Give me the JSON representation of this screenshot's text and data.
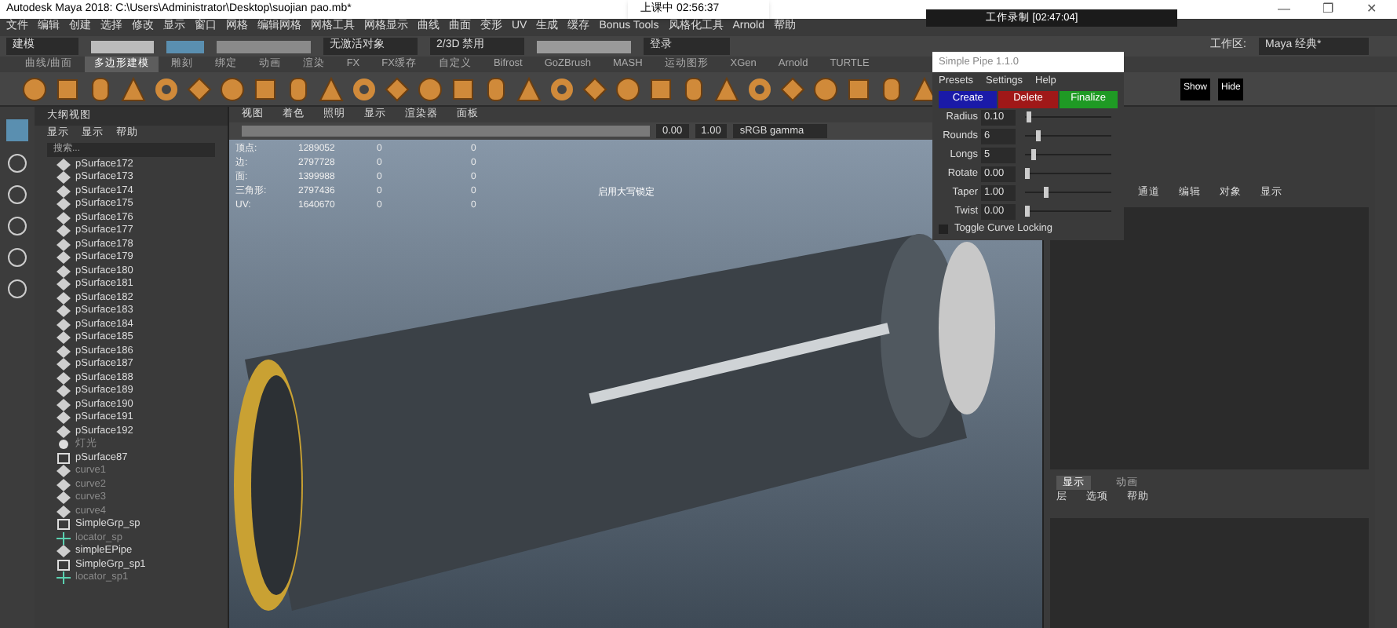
{
  "window": {
    "title": "Autodesk Maya 2018: C:\\Users\\Administrator\\Desktop\\suojian pao.mb*",
    "controls": [
      "—",
      "❐",
      "✕"
    ]
  },
  "recording_badge": {
    "text": "上课中 02:56:37"
  },
  "recorder_bar": {
    "text": "工作录制 [02:47:04]"
  },
  "menu_bar": [
    "文件",
    "编辑",
    "创建",
    "选择",
    "修改",
    "显示",
    "窗口",
    "网格",
    "编辑网格",
    "网格工具",
    "网格显示",
    "曲线",
    "曲面",
    "变形",
    "UV",
    "生成",
    "缓存",
    "Bonus Tools",
    "风格化工具",
    "Arnold",
    "帮助"
  ],
  "status_line": {
    "mode": "建模",
    "field_1": "无激活对象",
    "field_2": "2/3D 禁用",
    "login": "登录",
    "workspace_label": "工作区:",
    "workspace": "Maya 经典*"
  },
  "shelf_tabs": [
    {
      "label": "曲线/曲面",
      "selected": false
    },
    {
      "label": "多边形建模",
      "selected": true
    },
    {
      "label": "雕刻",
      "selected": false
    },
    {
      "label": "绑定",
      "selected": false
    },
    {
      "label": "动画",
      "selected": false
    },
    {
      "label": "渲染",
      "selected": false
    },
    {
      "label": "FX",
      "selected": false
    },
    {
      "label": "FX缓存",
      "selected": false
    },
    {
      "label": "自定义",
      "selected": false
    },
    {
      "label": "Bifrost",
      "selected": false
    },
    {
      "label": "GoZBrush",
      "selected": false
    },
    {
      "label": "MASH",
      "selected": false
    },
    {
      "label": "运动图形",
      "selected": false
    },
    {
      "label": "XGen",
      "selected": false
    },
    {
      "label": "Arnold",
      "selected": false
    },
    {
      "label": "TURTLE",
      "selected": false
    }
  ],
  "outliner": {
    "title": "大纲视图",
    "menu": [
      "显示",
      "显示",
      "帮助"
    ],
    "search": {
      "placeholder": "搜索..."
    },
    "items": [
      {
        "name": "pSurface172",
        "kind": "mesh",
        "hidden": false
      },
      {
        "name": "pSurface173",
        "kind": "mesh",
        "hidden": false
      },
      {
        "name": "pSurface174",
        "kind": "mesh",
        "hidden": false
      },
      {
        "name": "pSurface175",
        "kind": "mesh",
        "hidden": false
      },
      {
        "name": "pSurface176",
        "kind": "mesh",
        "hidden": false
      },
      {
        "name": "pSurface177",
        "kind": "mesh",
        "hidden": false
      },
      {
        "name": "pSurface178",
        "kind": "mesh",
        "hidden": false
      },
      {
        "name": "pSurface179",
        "kind": "mesh",
        "hidden": false
      },
      {
        "name": "pSurface180",
        "kind": "mesh",
        "hidden": false
      },
      {
        "name": "pSurface181",
        "kind": "mesh",
        "hidden": false
      },
      {
        "name": "pSurface182",
        "kind": "mesh",
        "hidden": false
      },
      {
        "name": "pSurface183",
        "kind": "mesh",
        "hidden": false
      },
      {
        "name": "pSurface184",
        "kind": "mesh",
        "hidden": false
      },
      {
        "name": "pSurface185",
        "kind": "mesh",
        "hidden": false
      },
      {
        "name": "pSurface186",
        "kind": "mesh",
        "hidden": false
      },
      {
        "name": "pSurface187",
        "kind": "mesh",
        "hidden": false
      },
      {
        "name": "pSurface188",
        "kind": "mesh",
        "hidden": false
      },
      {
        "name": "pSurface189",
        "kind": "mesh",
        "hidden": false
      },
      {
        "name": "pSurface190",
        "kind": "mesh",
        "hidden": false
      },
      {
        "name": "pSurface191",
        "kind": "mesh",
        "hidden": false
      },
      {
        "name": "pSurface192",
        "kind": "mesh",
        "hidden": false
      },
      {
        "name": "灯光",
        "kind": "light",
        "hidden": true
      },
      {
        "name": "pSurface87",
        "kind": "group",
        "hidden": false
      },
      {
        "name": "curve1",
        "kind": "mesh",
        "hidden": true
      },
      {
        "name": "curve2",
        "kind": "mesh",
        "hidden": true
      },
      {
        "name": "curve3",
        "kind": "mesh",
        "hidden": true
      },
      {
        "name": "curve4",
        "kind": "mesh",
        "hidden": true
      },
      {
        "name": "SimpleGrp_sp",
        "kind": "group",
        "hidden": false
      },
      {
        "name": "locator_sp",
        "kind": "locator",
        "hidden": true
      },
      {
        "name": "simpleEPipe",
        "kind": "mesh",
        "hidden": false
      },
      {
        "name": "SimpleGrp_sp1",
        "kind": "group",
        "hidden": false
      },
      {
        "name": "locator_sp1",
        "kind": "locator",
        "hidden": true
      }
    ]
  },
  "viewport": {
    "menu": [
      "视图",
      "着色",
      "照明",
      "显示",
      "渲染器",
      "面板"
    ],
    "field_1": "0.00",
    "field_2": "1.00",
    "color_space": "sRGB gamma",
    "hud": [
      [
        "顶点:",
        "1289052",
        "0",
        "0"
      ],
      [
        "边:",
        "2797728",
        "0",
        "0"
      ],
      [
        "面:",
        "1399988",
        "0",
        "0"
      ],
      [
        "三角形:",
        "2797436",
        "0",
        "0"
      ],
      [
        "UV:",
        "1640670",
        "0",
        "0"
      ]
    ],
    "caption": "启用大写锁定"
  },
  "simple_pipe": {
    "title": "Simple Pipe 1.1.0",
    "menu": [
      "Presets",
      "Settings",
      "Help"
    ],
    "buttons": [
      {
        "label": "Create",
        "color": "#1a1aa8"
      },
      {
        "label": "Delete",
        "color": "#a01818"
      },
      {
        "label": "Finalize",
        "color": "#1f9a24"
      }
    ],
    "sliders": [
      {
        "label": "Radius",
        "value": "0.10",
        "level": 0.02
      },
      {
        "label": "Rounds",
        "value": "6",
        "level": 0.12
      },
      {
        "label": "Longs",
        "value": "5",
        "level": 0.08
      },
      {
        "label": "Rotate",
        "value": "0.00",
        "level": 0
      },
      {
        "label": "Taper",
        "value": "1.00",
        "level": 0.22
      },
      {
        "label": "Twist",
        "value": "0.00",
        "level": 0
      }
    ],
    "checkbox": {
      "label": "Toggle Curve Locking",
      "checked": false
    }
  },
  "shelf_extra": [
    "Show",
    "Hide"
  ],
  "channel_box": {
    "menu": [
      "通道",
      "编辑",
      "对象",
      "显示"
    ]
  },
  "layer_editor": {
    "tabs": [
      {
        "label": "显示",
        "selected": true
      },
      {
        "label": "动画",
        "selected": false
      }
    ],
    "menu": [
      "层",
      "选项",
      "帮助"
    ]
  }
}
